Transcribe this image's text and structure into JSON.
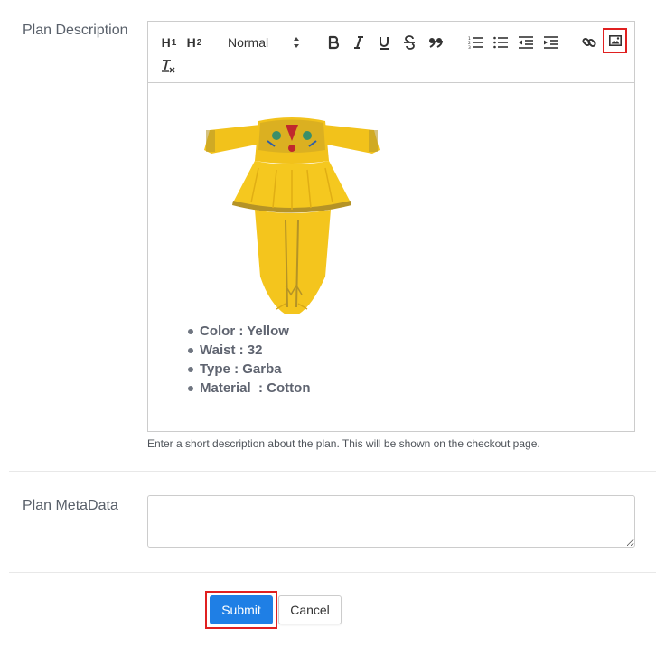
{
  "description_field": {
    "label": "Plan Description",
    "help_text": "Enter a short description about the plan. This will be shown on the checkout page.",
    "toolbar": {
      "h1_label": "H",
      "h1_sub": "1",
      "h2_label": "H",
      "h2_sub": "2",
      "size_value": "Normal",
      "icons": [
        "bold-icon",
        "italic-icon",
        "underline-icon",
        "strike-icon",
        "blockquote-icon",
        "ordered-list-icon",
        "bullet-list-icon",
        "outdent-icon",
        "indent-icon",
        "link-icon",
        "image-icon",
        "clear-format-icon"
      ],
      "highlight_color": "#e02020"
    },
    "content": {
      "image": "yellow-garba-dress",
      "bullets": [
        "Color : Yellow",
        "Waist : 32",
        "Type : Garba",
        "Material  : Cotton"
      ]
    }
  },
  "metadata_field": {
    "label": "Plan MetaData",
    "value": ""
  },
  "actions": {
    "submit_label": "Submit",
    "cancel_label": "Cancel",
    "submit_color": "#1f7fe5"
  }
}
